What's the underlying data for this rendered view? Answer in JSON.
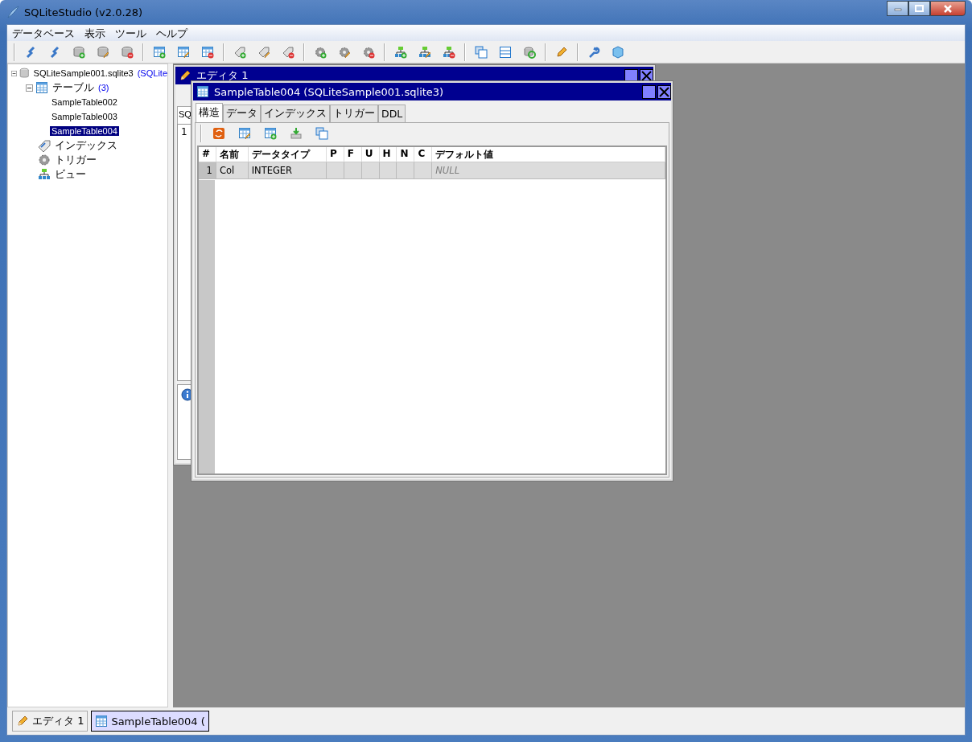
{
  "window": {
    "title": "SQLiteStudio (v2.0.28)"
  },
  "menu": [
    "データベース",
    "表示",
    "ツール",
    "ヘルプ"
  ],
  "tree": [
    {
      "label": "SQLiteSample001.sqlite3",
      "note": "(SQLite",
      "kind": "database",
      "expanded": true,
      "selected": false,
      "children": [
        {
          "label": "テーブル",
          "note": "(3)",
          "kind": "tables",
          "expanded": true,
          "selected": false,
          "children": [
            {
              "label": "SampleTable002",
              "kind": "table",
              "selected": false
            },
            {
              "label": "SampleTable003",
              "kind": "table",
              "selected": false
            },
            {
              "label": "SampleTable004",
              "kind": "table",
              "selected": true
            }
          ]
        },
        {
          "label": "インデックス",
          "kind": "indexes",
          "selected": false
        },
        {
          "label": "トリガー",
          "kind": "triggers",
          "selected": false
        },
        {
          "label": "ビュー",
          "kind": "views",
          "selected": false
        }
      ]
    }
  ],
  "editor_window": {
    "title": "エディタ 1",
    "tab": "SQ",
    "line_number": "1"
  },
  "table_window": {
    "title": "SampleTable004 (SQLiteSample001.sqlite3)",
    "tabs": [
      {
        "label": "構造",
        "selected": true
      },
      {
        "label": "データ",
        "selected": false
      },
      {
        "label": "インデックス",
        "selected": false
      },
      {
        "label": "トリガー",
        "selected": false
      },
      {
        "label": "DDL",
        "selected": false
      }
    ],
    "columns": [
      "#",
      "名前",
      "データタイプ",
      "P",
      "F",
      "U",
      "H",
      "N",
      "C",
      "デフォルト値"
    ],
    "rows": [
      {
        "number": "1",
        "name": "Col",
        "type": "INTEGER",
        "default": "NULL"
      }
    ]
  },
  "taskbar": [
    {
      "label": "エディタ 1",
      "kind": "editor",
      "selected": false
    },
    {
      "label": "SampleTable004 (",
      "kind": "table",
      "selected": true
    }
  ]
}
